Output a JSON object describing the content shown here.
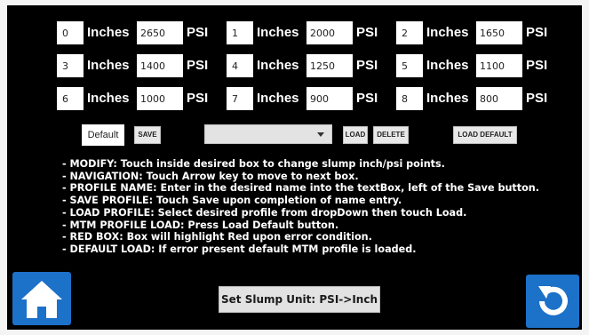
{
  "labels": {
    "inches": "Inches",
    "psi": "PSI"
  },
  "slump_points": [
    {
      "inch": "0",
      "psi": "2650"
    },
    {
      "inch": "1",
      "psi": "2000"
    },
    {
      "inch": "2",
      "psi": "1650"
    },
    {
      "inch": "3",
      "psi": "1400"
    },
    {
      "inch": "4",
      "psi": "1250"
    },
    {
      "inch": "5",
      "psi": "1100"
    },
    {
      "inch": "6",
      "psi": "1000"
    },
    {
      "inch": "7",
      "psi": "900"
    },
    {
      "inch": "8",
      "psi": "800"
    }
  ],
  "profile": {
    "name_value": "Default",
    "save_label": "SAVE",
    "dropdown_value": "",
    "load_label": "LOAD",
    "delete_label": "DELETE",
    "load_default_label": "LOAD DEFAULT"
  },
  "instructions": [
    "- MODIFY: Touch inside desired box to change slump inch/psi points.",
    "- NAVIGATION: Touch Arrow key to move to next box.",
    "- PROFILE NAME: Enter in the desired name into the textBox, left of the Save button.",
    "- SAVE PROFILE: Touch Save upon completion of name entry.",
    "- LOAD PROFILE: Select desired profile from dropDown then touch Load.",
    "- MTM PROFILE LOAD: Press Load Default button.",
    "- RED BOX: Box will highlight Red upon error condition.",
    "- DEFAULT LOAD: If error present default MTM profile is loaded."
  ],
  "set_slump_unit_label": "Set Slump Unit: PSI->Inch",
  "icons": {
    "home": "home-icon",
    "back": "back-arrow-icon"
  },
  "colors": {
    "background": "#000000",
    "button_blue": "#1c71c9",
    "field": "#ffffff",
    "label": "#ffffff"
  }
}
